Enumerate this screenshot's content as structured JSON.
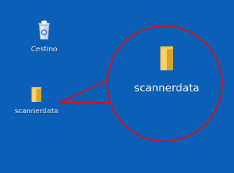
{
  "desktop": {
    "background_color": "#0c5fb6",
    "icons": [
      {
        "name": "recycle-bin-icon",
        "label": "Cestino"
      },
      {
        "name": "folder-icon",
        "label": "scannerdata"
      }
    ]
  },
  "zoom_callout": {
    "label": "scannerdata",
    "circle_color": "#d0121b",
    "icon": "folder-icon"
  }
}
